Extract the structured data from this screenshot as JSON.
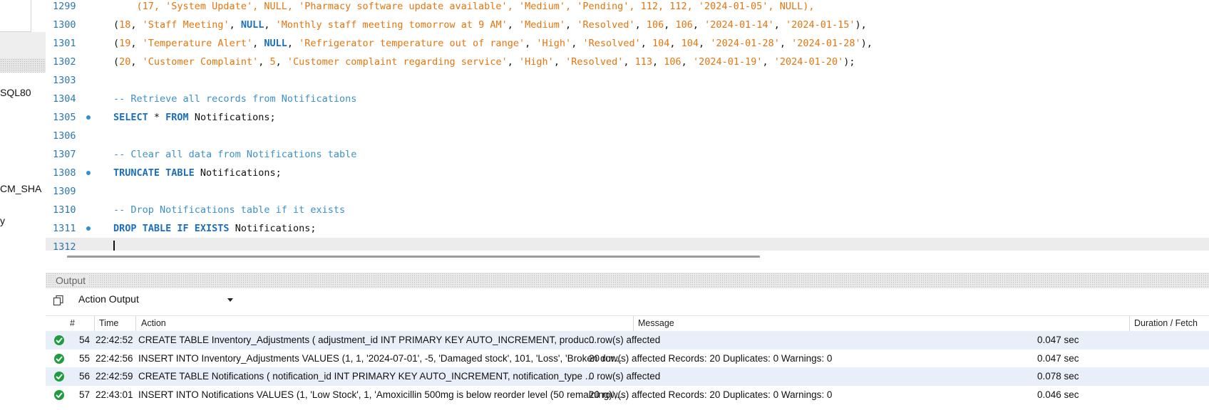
{
  "left_panel": {
    "items": [
      "SQL80",
      "CM_SHA",
      "y"
    ]
  },
  "editor": {
    "lines": [
      {
        "n": "1299",
        "segs": [
          [
            "p",
            "    "
          ],
          [
            "s",
            "(17, 'System Update', NULL, 'Pharmacy software update available', 'Medium', 'Pending', 112, 112, '2024-01-05', NULL),"
          ]
        ]
      },
      {
        "n": "1300",
        "segs": [
          [
            "p",
            "("
          ],
          [
            "s",
            "18"
          ],
          [
            "p",
            ", "
          ],
          [
            "s",
            "'Staff Meeting'"
          ],
          [
            "p",
            ", "
          ],
          [
            "k",
            "NULL"
          ],
          [
            "p",
            ", "
          ],
          [
            "s",
            "'Monthly staff meeting tomorrow at 9 AM'"
          ],
          [
            "p",
            ", "
          ],
          [
            "s",
            "'Medium'"
          ],
          [
            "p",
            ", "
          ],
          [
            "s",
            "'Resolved'"
          ],
          [
            "p",
            ", "
          ],
          [
            "s",
            "106"
          ],
          [
            "p",
            ", "
          ],
          [
            "s",
            "106"
          ],
          [
            "p",
            ", "
          ],
          [
            "s",
            "'2024-01-14'"
          ],
          [
            "p",
            ", "
          ],
          [
            "s",
            "'2024-01-15'"
          ],
          [
            "p",
            "),"
          ]
        ]
      },
      {
        "n": "1301",
        "segs": [
          [
            "p",
            "("
          ],
          [
            "s",
            "19"
          ],
          [
            "p",
            ", "
          ],
          [
            "s",
            "'Temperature Alert'"
          ],
          [
            "p",
            ", "
          ],
          [
            "k",
            "NULL"
          ],
          [
            "p",
            ", "
          ],
          [
            "s",
            "'Refrigerator temperature out of range'"
          ],
          [
            "p",
            ", "
          ],
          [
            "s",
            "'High'"
          ],
          [
            "p",
            ", "
          ],
          [
            "s",
            "'Resolved'"
          ],
          [
            "p",
            ", "
          ],
          [
            "s",
            "104"
          ],
          [
            "p",
            ", "
          ],
          [
            "s",
            "104"
          ],
          [
            "p",
            ", "
          ],
          [
            "s",
            "'2024-01-28'"
          ],
          [
            "p",
            ", "
          ],
          [
            "s",
            "'2024-01-28'"
          ],
          [
            "p",
            "),"
          ]
        ]
      },
      {
        "n": "1302",
        "segs": [
          [
            "p",
            "("
          ],
          [
            "s",
            "20"
          ],
          [
            "p",
            ", "
          ],
          [
            "s",
            "'Customer Complaint'"
          ],
          [
            "p",
            ", "
          ],
          [
            "s",
            "5"
          ],
          [
            "p",
            ", "
          ],
          [
            "s",
            "'Customer complaint regarding service'"
          ],
          [
            "p",
            ", "
          ],
          [
            "s",
            "'High'"
          ],
          [
            "p",
            ", "
          ],
          [
            "s",
            "'Resolved'"
          ],
          [
            "p",
            ", "
          ],
          [
            "s",
            "113"
          ],
          [
            "p",
            ", "
          ],
          [
            "s",
            "106"
          ],
          [
            "p",
            ", "
          ],
          [
            "s",
            "'2024-01-19'"
          ],
          [
            "p",
            ", "
          ],
          [
            "s",
            "'2024-01-20'"
          ],
          [
            "p",
            ");"
          ]
        ]
      },
      {
        "n": "1303",
        "segs": []
      },
      {
        "n": "1304",
        "segs": [
          [
            "c",
            "-- Retrieve all records from Notifications"
          ]
        ]
      },
      {
        "n": "1305",
        "dot": true,
        "segs": [
          [
            "k",
            "SELECT"
          ],
          [
            "p",
            " * "
          ],
          [
            "k",
            "FROM"
          ],
          [
            "p",
            " Notifications;"
          ]
        ]
      },
      {
        "n": "1306",
        "segs": []
      },
      {
        "n": "1307",
        "segs": [
          [
            "c",
            "-- Clear all data from Notifications table"
          ]
        ]
      },
      {
        "n": "1308",
        "dot": true,
        "segs": [
          [
            "k",
            "TRUNCATE TABLE"
          ],
          [
            "p",
            " Notifications;"
          ]
        ]
      },
      {
        "n": "1309",
        "segs": []
      },
      {
        "n": "1310",
        "segs": [
          [
            "c",
            "-- Drop Notifications table if it exists"
          ]
        ]
      },
      {
        "n": "1311",
        "dot": true,
        "segs": [
          [
            "k",
            "DROP TABLE IF EXISTS"
          ],
          [
            "p",
            " Notifications;"
          ]
        ]
      },
      {
        "n": "1312",
        "current": true,
        "segs": []
      }
    ]
  },
  "output": {
    "title": "Output",
    "selector": "Action Output",
    "columns": {
      "num": "#",
      "time": "Time",
      "action": "Action",
      "message": "Message",
      "duration": "Duration / Fetch"
    },
    "rows": [
      {
        "num": "54",
        "time": "22:42:52",
        "action": "CREATE TABLE Inventory_Adjustments (     adjustment_id INT PRIMARY KEY AUTO_INCREMENT,     produc...",
        "message": "0 row(s) affected",
        "duration": "0.047 sec"
      },
      {
        "num": "55",
        "time": "22:42:56",
        "action": "INSERT INTO Inventory_Adjustments VALUES (1, 1, '2024-07-01', -5, 'Damaged stock', 101, 'Loss', 'Broken dur...",
        "message": "20 row(s) affected Records: 20  Duplicates: 0  Warnings: 0",
        "duration": "0.047 sec"
      },
      {
        "num": "56",
        "time": "22:42:59",
        "action": "CREATE TABLE Notifications (     notification_id INT PRIMARY KEY AUTO_INCREMENT,     notification_type ...",
        "message": "0 row(s) affected",
        "duration": "0.078 sec"
      },
      {
        "num": "57",
        "time": "22:43:01",
        "action": "INSERT INTO Notifications VALUES (1, 'Low Stock', 1, 'Amoxicillin 500mg is below reorder level (50 remaining)',...",
        "message": "20 row(s) affected Records: 20  Duplicates: 0  Warnings: 0",
        "duration": "0.046 sec"
      }
    ]
  },
  "colors": {
    "string": "#e6750b",
    "keyword": "#1b6fc0",
    "comment": "#3a91c9",
    "success": "#1f9d3e",
    "selected_row": "#e8eff9"
  }
}
